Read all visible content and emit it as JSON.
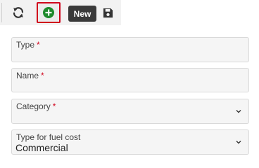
{
  "toolbar": {
    "refresh_icon": "refresh-icon",
    "add_icon": "plus-circle-icon",
    "save_icon": "floppy-disk-icon",
    "tooltip": "New",
    "colors": {
      "add_green": "#1e8a2c",
      "highlight_red": "#d0021b"
    }
  },
  "form": {
    "type": {
      "label": "Type",
      "required_mark": "*",
      "value": ""
    },
    "name": {
      "label": "Name",
      "required_mark": "*",
      "value": ""
    },
    "category": {
      "label": "Category",
      "required_mark": "*",
      "value": ""
    },
    "fuel_cost_type": {
      "label": "Type for fuel cost",
      "value": "Commercial"
    }
  }
}
